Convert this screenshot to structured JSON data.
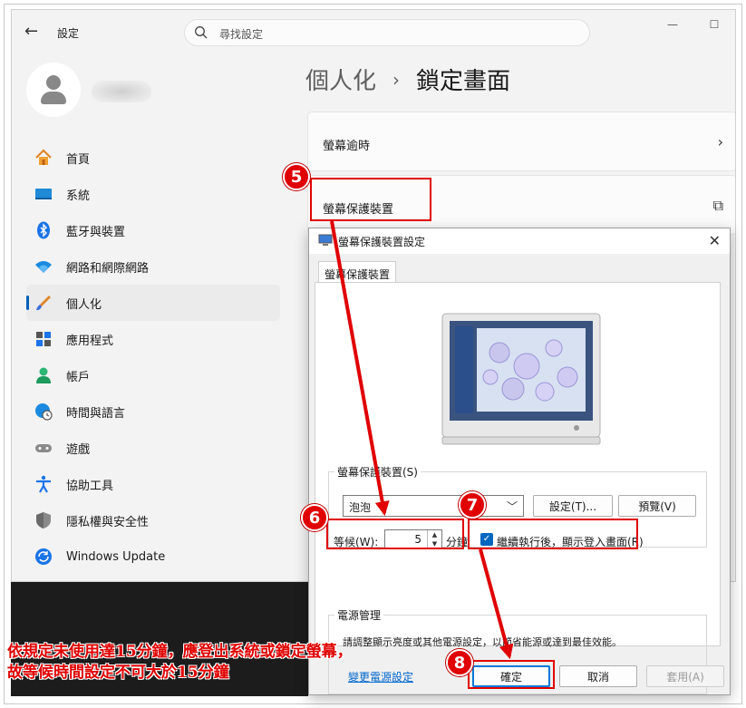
{
  "settings": {
    "app_title": "設定",
    "search_placeholder": "尋找設定",
    "breadcrumb_parent": "個人化",
    "breadcrumb_current": "鎖定畫面",
    "nav": [
      {
        "label": "首頁",
        "icon": "home-icon"
      },
      {
        "label": "系統",
        "icon": "display-icon"
      },
      {
        "label": "藍牙與裝置",
        "icon": "bluetooth-icon"
      },
      {
        "label": "網路和網際網路",
        "icon": "wifi-icon"
      },
      {
        "label": "個人化",
        "icon": "brush-icon",
        "active": true
      },
      {
        "label": "應用程式",
        "icon": "apps-icon"
      },
      {
        "label": "帳戶",
        "icon": "person-icon"
      },
      {
        "label": "時間與語言",
        "icon": "globe-clock-icon"
      },
      {
        "label": "遊戲",
        "icon": "gamepad-icon"
      },
      {
        "label": "協助工具",
        "icon": "accessibility-icon"
      },
      {
        "label": "隱私權與安全性",
        "icon": "shield-icon"
      },
      {
        "label": "Windows Update",
        "icon": "update-icon"
      }
    ],
    "cards": [
      {
        "label": "螢幕逾時",
        "arrow": "›"
      },
      {
        "label": "螢幕保護裝置",
        "arrow": "⧉"
      }
    ]
  },
  "dialog": {
    "title": "螢幕保護裝置設定",
    "tab": "螢幕保護裝置",
    "screensaver_group": "螢幕保護裝置(S)",
    "screensaver_value": "泡泡",
    "settings_button": "設定(T)...",
    "preview_button": "預覽(V)",
    "wait_label": "等候(W):",
    "wait_value": "5",
    "minutes_label": "分鐘",
    "resume_checkbox": "繼續執行後，顯示登入畫面(R)",
    "resume_checked": true,
    "power_group": "電源管理",
    "power_desc": "請調整顯示亮度或其他電源設定，以節省能源或達到最佳效能。",
    "power_link": "變更電源設定",
    "ok_button": "確定",
    "cancel_button": "取消",
    "apply_button": "套用(A)"
  },
  "annotations": {
    "badges": [
      "5",
      "6",
      "7",
      "8"
    ],
    "note_line1": "依規定未使用達15分鐘，應登出系統或鎖定螢幕，",
    "note_line2": "故等候時間設定不可大於15分鐘",
    "accent_color": "#e00000"
  }
}
